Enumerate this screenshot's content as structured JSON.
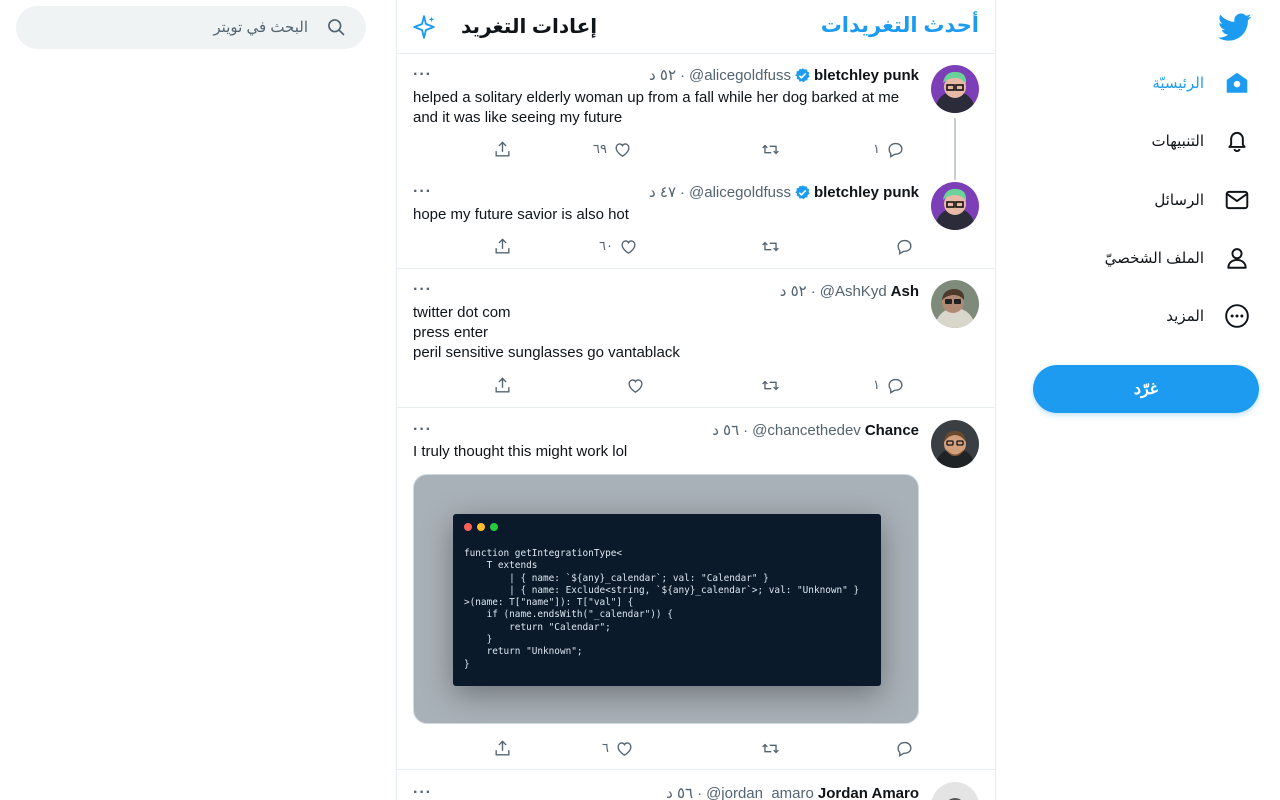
{
  "search": {
    "placeholder": "البحث في تويتر"
  },
  "header": {
    "title": "أحدث التغريدات",
    "settings_label": "إعادات التغريد"
  },
  "nav": {
    "items": [
      {
        "label": "الرئيسيّة",
        "icon": "home-icon",
        "active": true
      },
      {
        "label": "التنبيهات",
        "icon": "bell-icon"
      },
      {
        "label": "الرسائل",
        "icon": "mail-icon"
      },
      {
        "label": "الملف الشخصيّ",
        "icon": "profile-icon"
      },
      {
        "label": "المزيد",
        "icon": "more-circle-icon"
      }
    ],
    "tweet_button": "غرّد"
  },
  "tweets": [
    {
      "name": "bletchley punk",
      "handle": "@alicegoldfuss",
      "time": "٥٢ د",
      "verified": true,
      "text": "helped a solitary elderly woman up from a fall while her dog barked at me and it was like seeing my future",
      "replies": "١",
      "retweets": "",
      "likes": "٦٩"
    },
    {
      "name": "bletchley punk",
      "handle": "@alicegoldfuss",
      "time": "٤٧ د",
      "verified": true,
      "text": "hope my future savior is also hot",
      "replies": "",
      "retweets": "",
      "likes": "٦٠"
    },
    {
      "name": "Ash",
      "handle": "@AshKyd",
      "time": "٥٢ د",
      "verified": false,
      "text_lines": [
        "twitter dot com",
        "press enter",
        "peril sensitive sunglasses go vantablack"
      ],
      "replies": "١",
      "retweets": "",
      "likes": ""
    },
    {
      "name": "Chance",
      "handle": "@chancethedev",
      "time": "٥٦ د",
      "verified": false,
      "text": "I truly thought this might work lol",
      "replies": "",
      "retweets": "",
      "likes": "٦",
      "code_lines": [
        "function getIntegrationType<",
        "    T extends",
        "        | { name: `${any}_calendar`; val: \"Calendar\" }",
        "        | { name: Exclude<string, `${any}_calendar`>; val: \"Unknown\" }",
        ">(name: T[\"name\"]): T[\"val\"] {",
        "    if (name.endsWith(\"_calendar\")) {",
        "        return \"Calendar\";",
        "    }",
        "    return \"Unknown\";",
        "}"
      ]
    },
    {
      "name": "Jordan Amaro",
      "handle": "@jordan_amaro",
      "time": "٥٦ د",
      "verified": false
    }
  ],
  "colors": {
    "accent": "#1d9bf0",
    "text": "#0f1419",
    "muted": "#536471",
    "border": "#e6ecf0"
  }
}
